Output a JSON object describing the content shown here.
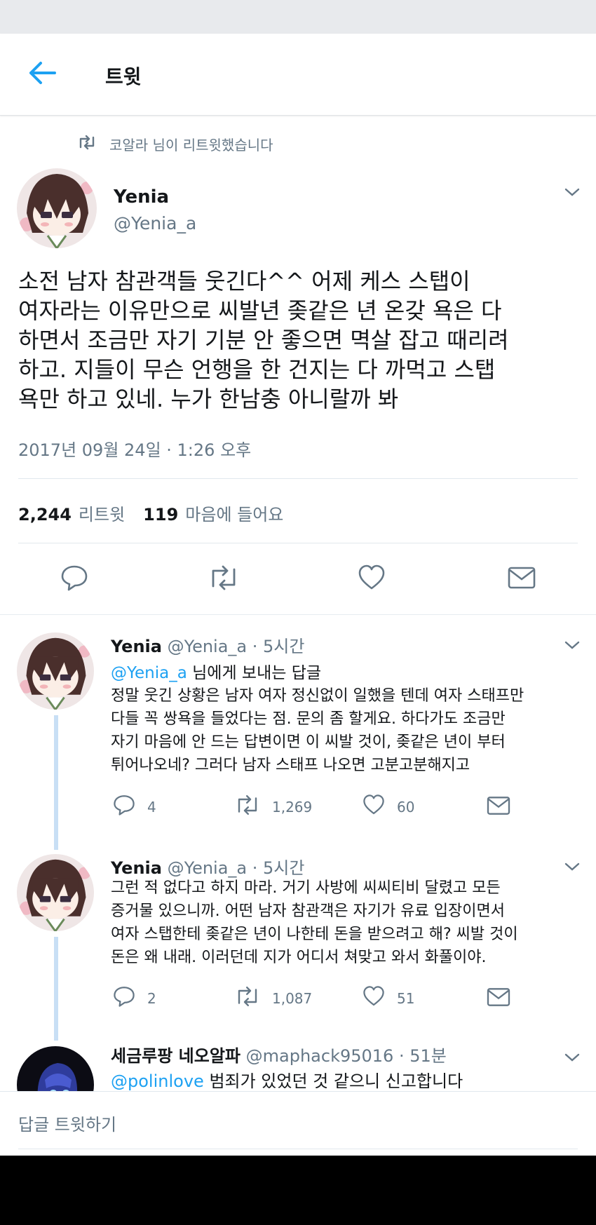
{
  "header": {
    "title": "트윗"
  },
  "retweet_banner": {
    "text": "코알라 님이 리트윗했습니다"
  },
  "tweet": {
    "name": "Yenia",
    "handle": "@Yenia_a",
    "lines": [
      "소전 남자 참관객들 웃긴다^^ 어제 케스 스탭이",
      "여자라는 이유만으로 씨발년 좆같은 년 온갖 욕은 다",
      "하면서 조금만 자기 기분 안 좋으면 멱살 잡고 때리려",
      "하고. 지들이 무슨 언행을 한 건지는 다 까먹고 스탭",
      "욕만 하고 있네. 누가 한남충 아니랄까 봐"
    ],
    "date": "2017년 09월 24일 · 1:26 오후",
    "retweets": "2,244",
    "retweets_label": "리트윗",
    "likes": "119",
    "likes_label": "마음에 들어요"
  },
  "replies": [
    {
      "name": "Yenia",
      "handle": "@Yenia_a",
      "time": "· 5시간",
      "replying_to": "@Yenia_a",
      "replying_suffix": "님에게 보내는 답글",
      "lines": [
        "정말 웃긴 상황은 남자 여자 정신없이 일했을 텐데 여자 스태프만",
        "다들 꼭 쌍욕을 들었다는 점. 문의 좀 할게요. 하다가도 조금만",
        "자기 마음에 안 드는 답변이면 이 씨발 것이, 좆같은 년이 부터",
        "튀어나오네? 그러다 남자 스태프 나오면 고분고분해지고"
      ],
      "reply_count": "4",
      "retweet_count": "1,269",
      "like_count": "60"
    },
    {
      "name": "Yenia",
      "handle": "@Yenia_a",
      "time": "· 5시간",
      "lines": [
        "그런 적 없다고 하지 마라. 거기 사방에 씨씨티비 달렸고 모든",
        "증거물 있으니까. 어떤 남자 참관객은 자기가 유료 입장이면서",
        "여자 스탭한테 좆같은 년이 나한테 돈을 받으려고 해? 씨발 것이",
        "돈은 왜 내래. 이러던데 지가 어디서 쳐맞고 와서 화풀이야."
      ],
      "reply_count": "2",
      "retweet_count": "1,087",
      "like_count": "51"
    },
    {
      "name": "세금루팡 네오알파",
      "handle": "@maphack95016",
      "time": "· 51분",
      "mention": "@polinlove",
      "text": "범죄가 있었던 것 같으니 신고합니다"
    }
  ],
  "compose": {
    "placeholder": "답글 트윗하기"
  },
  "colors": {
    "accent": "#1da1f2",
    "muted": "#657786",
    "text": "#14171a",
    "thread_line": "#c8dff5"
  }
}
